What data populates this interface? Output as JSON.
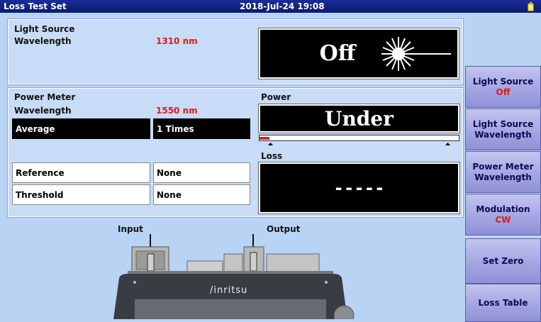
{
  "titlebar": {
    "title": "Loss Test Set",
    "datetime": "2018-Jul-24 19:08"
  },
  "light_source": {
    "heading": "Light Source",
    "wavelength_label": "Wavelength",
    "wavelength_value": "1310 nm",
    "status": "Off"
  },
  "power_meter": {
    "heading": "Power Meter",
    "wavelength_label": "Wavelength",
    "wavelength_value": "1550 nm",
    "average_label": "Average",
    "average_value": "1 Times",
    "reference_label": "Reference",
    "reference_value": "None",
    "threshold_label": "Threshold",
    "threshold_value": "None",
    "power_label": "Power",
    "power_value": "Under",
    "power_bar_fraction": 0.05,
    "loss_label": "Loss",
    "loss_value": "-----"
  },
  "diagram": {
    "input_label": "Input",
    "output_label": "Output",
    "brand": "/inritsu"
  },
  "softkeys": [
    {
      "line1": "Light Source",
      "value": "Off"
    },
    {
      "line1": "Light Source",
      "line2": "Wavelength"
    },
    {
      "line1": "Power Meter",
      "line2": "Wavelength"
    },
    {
      "line1": "Modulation",
      "value": "CW"
    },
    {
      "line1": "Set Zero"
    },
    {
      "line1": "Loss Table"
    }
  ],
  "colors": {
    "title_bar": "#0b1a6e",
    "background": "#b9d3f5",
    "value_red": "#e21a1a",
    "softkey": "#a4a6e2"
  }
}
